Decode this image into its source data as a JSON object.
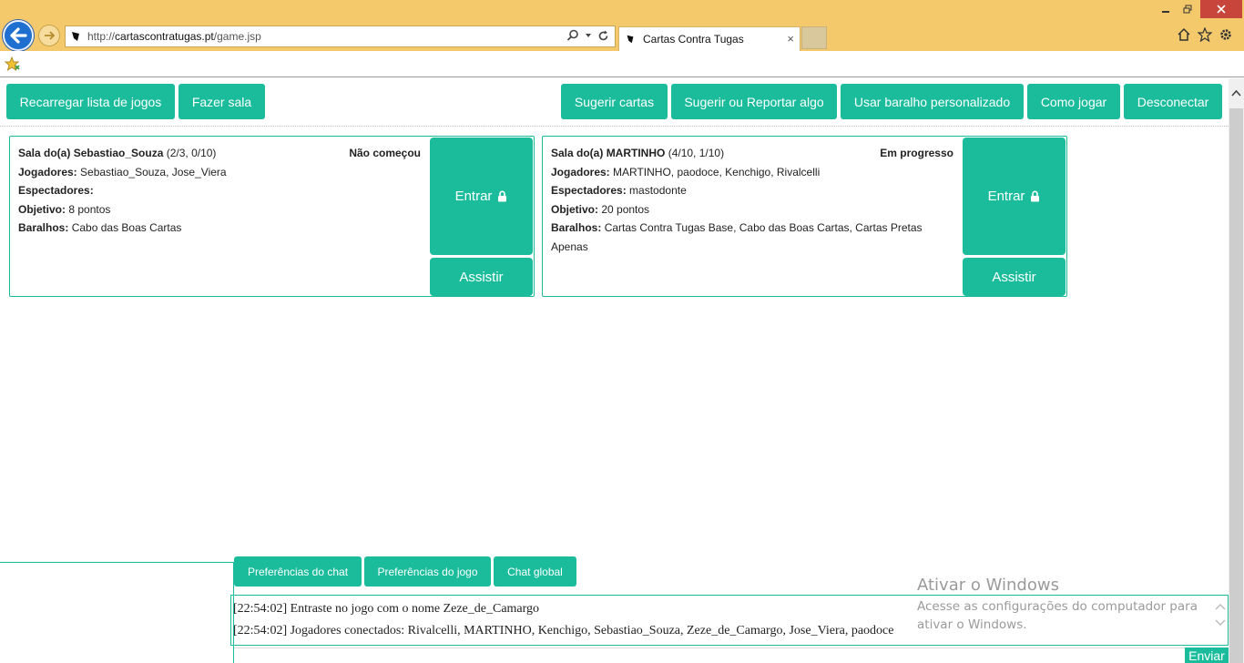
{
  "browser": {
    "url_prefix": "http://",
    "url_domain": "cartascontratugas.pt",
    "url_path": "/game.jsp",
    "tab_title": "Cartas Contra Tugas",
    "tab_close": "×"
  },
  "toolbar": {
    "reload_label": "Recarregar lista de jogos",
    "create_room_label": "Fazer sala",
    "suggest_cards_label": "Sugerir cartas",
    "report_label": "Sugerir ou Reportar algo",
    "custom_deck_label": "Usar baralho personalizado",
    "how_to_play_label": "Como jogar",
    "disconnect_label": "Desconectar"
  },
  "rooms": [
    {
      "title_prefix": "Sala do(a) ",
      "host": "Sebastiao_Souza",
      "counts": " (2/3, 0/10)",
      "status": "Não começou",
      "players_label": "Jogadores:",
      "players": " Sebastiao_Souza, Jose_Viera",
      "spectators_label": "Espectadores:",
      "spectators": "",
      "goal_label": "Objetivo:",
      "goal": " 8 pontos",
      "decks_label": "Baralhos:",
      "decks": " Cabo das Boas Cartas",
      "enter_label": "Entrar",
      "watch_label": "Assistir"
    },
    {
      "title_prefix": "Sala do(a) ",
      "host": "MARTINHO",
      "counts": " (4/10, 1/10)",
      "status": "Em progresso",
      "players_label": "Jogadores:",
      "players": " MARTINHO, paodoce, Kenchigo, Rivalcelli",
      "spectators_label": "Espectadores:",
      "spectators": " mastodonte",
      "goal_label": "Objetivo:",
      "goal": " 20 pontos",
      "decks_label": "Baralhos:",
      "decks": " Cartas Contra Tugas Base, Cabo das Boas Cartas, Cartas Pretas Apenas",
      "enter_label": "Entrar",
      "watch_label": "Assistir"
    }
  ],
  "chat": {
    "tabs": [
      "Preferências do chat",
      "Preferências do jogo",
      "Chat global"
    ],
    "messages": [
      "[22:54:02] Entraste no jogo com o nome Zeze_de_Camargo",
      "[22:54:02] Jogadores conectados: Rivalcelli, MARTINHO, Kenchigo, Sebastiao_Souza, Zeze_de_Camargo, Jose_Viera, paodoce"
    ],
    "send_label": "Enviar"
  },
  "watermark": {
    "title": "Ativar o Windows",
    "subtitle": "Acesse as configurações do computador para ativar o Windows."
  },
  "colors": {
    "accent": "#1abc9c",
    "titlebar": "#f3c96b"
  }
}
